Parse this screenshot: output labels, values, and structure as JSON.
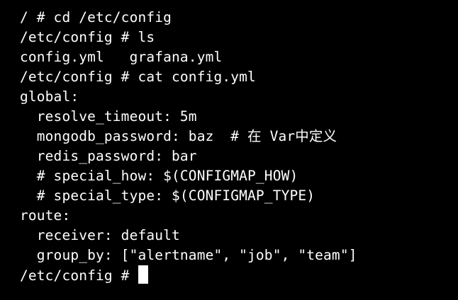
{
  "terminal": {
    "lines": [
      "/ # cd /etc/config",
      "/etc/config # ls",
      "config.yml   grafana.yml",
      "/etc/config # cat config.yml",
      "global:",
      "  resolve_timeout: 5m",
      "  mongodb_password: baz  # 在 Var中定义",
      "  redis_password: bar",
      "  # special_how: $(CONFIGMAP_HOW)",
      "  # special_type: $(CONFIGMAP_TYPE)",
      "route:",
      "  receiver: default",
      "  group_by: [\"alertname\", \"job\", \"team\"]"
    ],
    "prompt": "/etc/config # "
  },
  "colors": {
    "background": "#000000",
    "text": "#ffffff",
    "cursor": "#ffffff"
  }
}
